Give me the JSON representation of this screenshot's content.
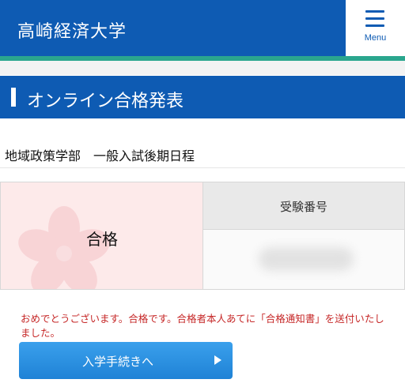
{
  "header": {
    "brand": "高崎経済大学",
    "menu_label": "Menu",
    "menu_icon": "hamburger-icon"
  },
  "section": {
    "title": "オンライン合格発表"
  },
  "department": "地域政策学部　一般入試後期日程",
  "result": {
    "status": "合格",
    "exam_number_header": "受験番号"
  },
  "message": "おめでとうございます。合格です。合格者本人あてに「合格通知書」を送付いたしました。",
  "proceed_button": {
    "label": "入学手続きへ",
    "icon": "play-right-icon"
  },
  "colors": {
    "brand_blue": "#0e5bb3",
    "accent_teal": "#2aa68e",
    "message_red": "#c62828",
    "button_blue": "#2b8fe2",
    "pass_bg": "#fdeaea"
  }
}
